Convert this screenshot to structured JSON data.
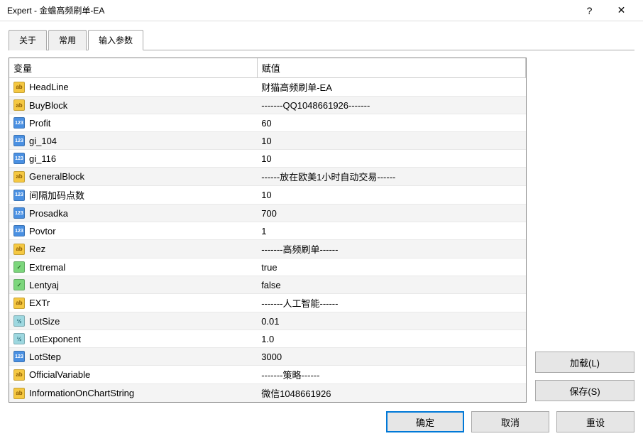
{
  "title": "Expert - 金蟾高频刷单-EA",
  "titlebar": {
    "help": "?",
    "close": "✕"
  },
  "tabs": [
    {
      "label": "关于"
    },
    {
      "label": "常用"
    },
    {
      "label": "输入参数",
      "active": true
    }
  ],
  "table": {
    "header_var": "变量",
    "header_val": "赋值",
    "rows": [
      {
        "icon": "ab",
        "name": "HeadLine",
        "value": "财猫高频刷单-EA"
      },
      {
        "icon": "ab",
        "name": "BuyBlock",
        "value": "-------QQ1048661926-------"
      },
      {
        "icon": "123",
        "name": "Profit",
        "value": "60"
      },
      {
        "icon": "123",
        "name": "gi_104",
        "value": "10"
      },
      {
        "icon": "123",
        "name": "gi_116",
        "value": "10"
      },
      {
        "icon": "ab",
        "name": "GeneralBlock",
        "value": "------放在欧美1小时自动交易------"
      },
      {
        "icon": "123",
        "name": "间隔加码点数",
        "value": "10"
      },
      {
        "icon": "123",
        "name": "Prosadka",
        "value": "700"
      },
      {
        "icon": "123",
        "name": "Povtor",
        "value": "1"
      },
      {
        "icon": "ab",
        "name": "Rez",
        "value": "-------高频刷单------"
      },
      {
        "icon": "bool",
        "name": "Extremal",
        "value": "true"
      },
      {
        "icon": "bool",
        "name": "Lentyaj",
        "value": "false"
      },
      {
        "icon": "ab",
        "name": "EXTr",
        "value": "-------人工智能------"
      },
      {
        "icon": "v2",
        "name": "LotSize",
        "value": "0.01"
      },
      {
        "icon": "v2",
        "name": "LotExponent",
        "value": "1.0"
      },
      {
        "icon": "123",
        "name": "LotStep",
        "value": "3000"
      },
      {
        "icon": "ab",
        "name": "OfficialVariable",
        "value": "-------策略------"
      },
      {
        "icon": "ab",
        "name": "InformationOnChartString",
        "value": "微信1048661926"
      }
    ]
  },
  "buttons": {
    "load": "加载(L)",
    "save": "保存(S)",
    "ok": "确定",
    "cancel": "取消",
    "reset": "重设"
  },
  "icon_glyphs": {
    "ab": "ab",
    "123": "123",
    "bool": "✓",
    "v2": "½"
  }
}
